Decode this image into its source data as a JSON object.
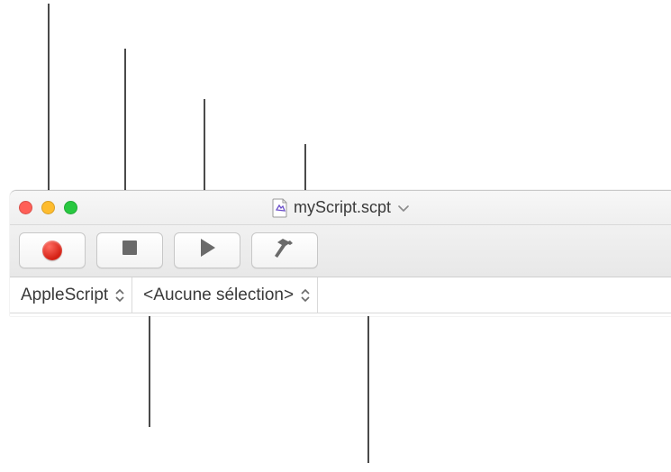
{
  "window": {
    "title": "myScript.scpt"
  },
  "toolbar": {
    "record_name": "record-button",
    "stop_name": "stop-button",
    "run_name": "run-button",
    "compile_name": "compile-button"
  },
  "navbar": {
    "language_label": "AppleScript",
    "selection_label": "<Aucune sélection>"
  },
  "icons": {
    "doc": "doc-icon",
    "chevron": "chevron-down-icon",
    "stepper": "stepper-icon"
  }
}
